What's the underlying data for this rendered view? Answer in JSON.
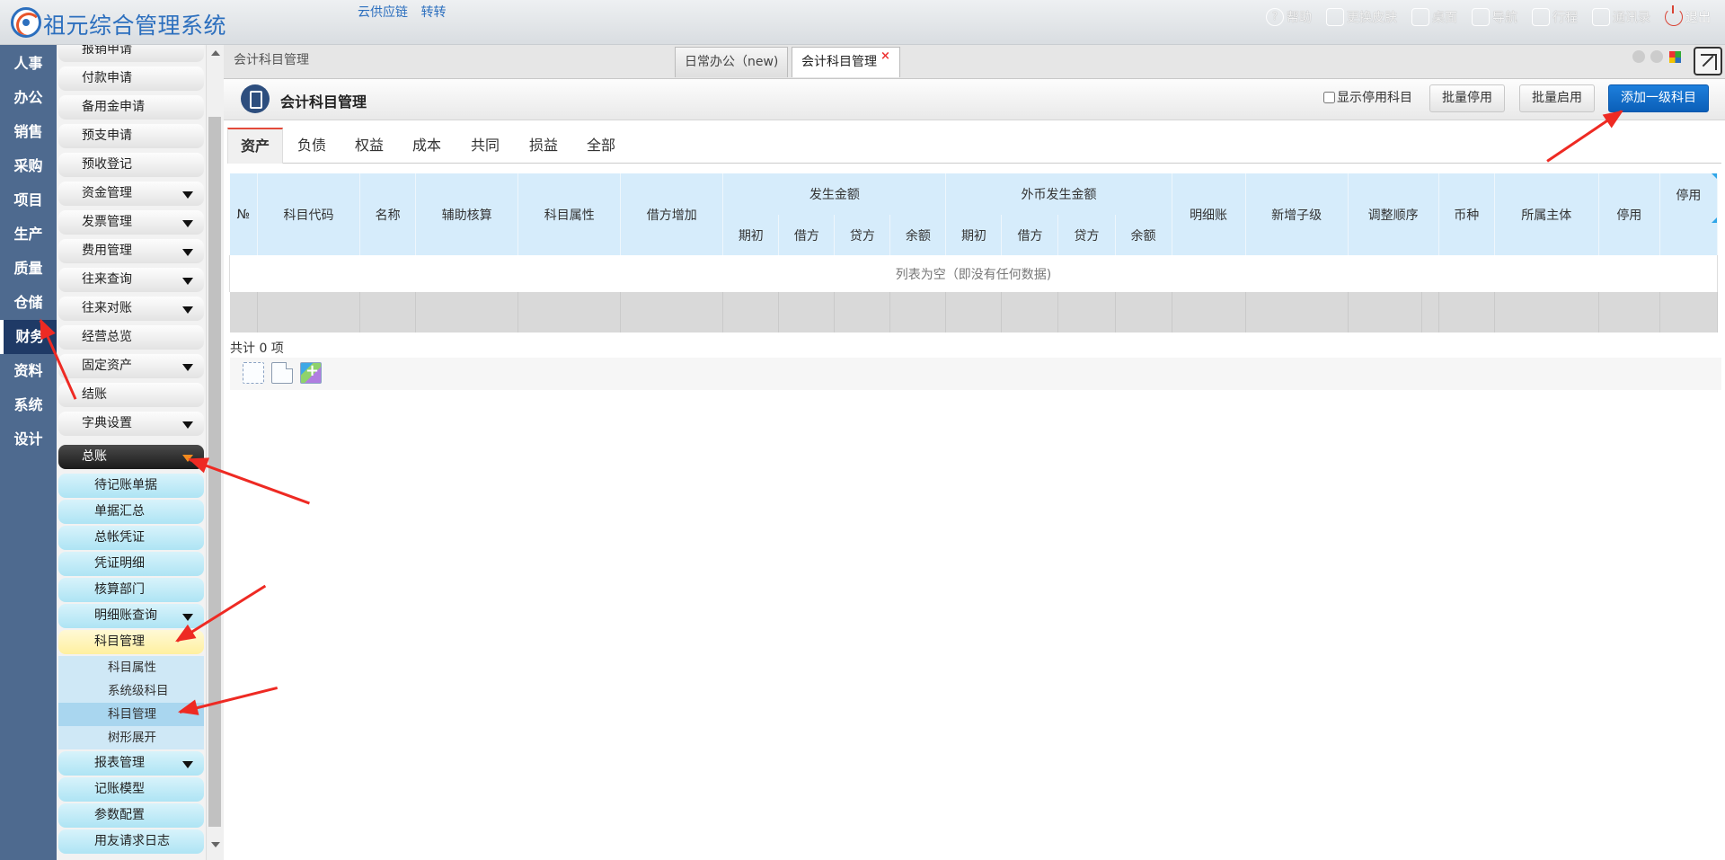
{
  "app": {
    "brand": "祖元综合管理系统",
    "quick_links": [
      "云供应链",
      "转转"
    ]
  },
  "top_actions": [
    {
      "label": "帮助",
      "icon": "help-icon"
    },
    {
      "label": "更换皮肤",
      "icon": "tshirt-icon"
    },
    {
      "label": "桌面",
      "icon": "home-icon"
    },
    {
      "label": "导航",
      "icon": "grid-icon"
    },
    {
      "label": "行程",
      "icon": "calendar-icon"
    },
    {
      "label": "通讯录",
      "icon": "contacts-icon"
    },
    {
      "label": "退出",
      "icon": "power-icon"
    }
  ],
  "modules": [
    "人事",
    "办公",
    "销售",
    "采购",
    "项目",
    "生产",
    "质量",
    "仓储",
    "财务",
    "资料",
    "系统",
    "设计"
  ],
  "active_module": "财务",
  "submenu": {
    "items": [
      "报销申请",
      "付款申请",
      "备用金申请",
      "预支申请",
      "预收登记",
      "资金管理",
      "发票管理",
      "费用管理",
      "往来查询",
      "往来对账",
      "经营总览",
      "固定资产",
      "结账",
      "字典设置"
    ],
    "group": "总账",
    "group_items": [
      "待记账单据",
      "单据汇总",
      "总帐凭证",
      "凭证明细",
      "核算部门",
      "明细账查询",
      "科目管理"
    ],
    "third_items": [
      "科目属性",
      "系统级科目",
      "科目管理",
      "树形展开"
    ],
    "after_items": [
      "报表管理",
      "记账模型",
      "参数配置",
      "用友请求日志"
    ]
  },
  "tabs": {
    "breadcrumb": "会计科目管理",
    "open": [
      {
        "label": "日常办公（new)"
      },
      {
        "label": "会计科目管理",
        "close": "×"
      }
    ]
  },
  "page": {
    "title": "会计科目管理",
    "show_disabled_label": "显示停用科目",
    "buttons": {
      "batch_disable": "批量停用",
      "batch_enable": "批量启用",
      "add_top": "添加一级科目"
    }
  },
  "category_tabs": [
    "资产",
    "负债",
    "权益",
    "成本",
    "共同",
    "损益",
    "全部"
  ],
  "active_category": "资产",
  "grid": {
    "columns": [
      "№",
      "科目代码",
      "名称",
      "辅助核算",
      "科目属性",
      "借方增加"
    ],
    "group1": {
      "label": "发生金额",
      "sub": [
        "期初",
        "借方",
        "贷方",
        "余额"
      ]
    },
    "group2": {
      "label": "外币发生金额",
      "sub": [
        "期初",
        "借方",
        "贷方",
        "余额"
      ]
    },
    "tail_columns": [
      "明细账",
      "新增子级",
      "调整顺序",
      "币种",
      "所属主体",
      "停用"
    ],
    "extra_header": "停用",
    "empty_text": "列表为空（即没有任何数据)",
    "total_text": "共计 0 项"
  },
  "colors": {
    "accent": "#0b5fb8",
    "header": "#d6ecfb",
    "sidebar": "#4e6a8f",
    "annotation": "#ee2a23"
  }
}
